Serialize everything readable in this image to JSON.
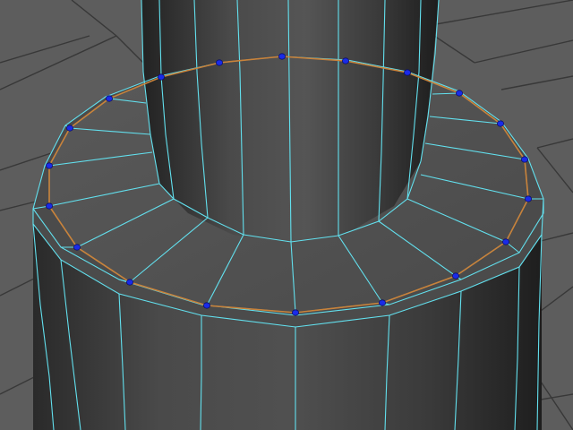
{
  "viewport": {
    "name": "3d-viewport",
    "background": "#5d5d5d",
    "grid_color": "#383838",
    "wire_color": "#62e0ee",
    "selected_edge_color": "#c9823a",
    "vertex_color": "#1a2be8"
  },
  "mesh": {
    "description": "stacked-cylinders-with-edge-loop",
    "selected_loop_vertex_count": 20,
    "selection_mode": "vertex"
  }
}
